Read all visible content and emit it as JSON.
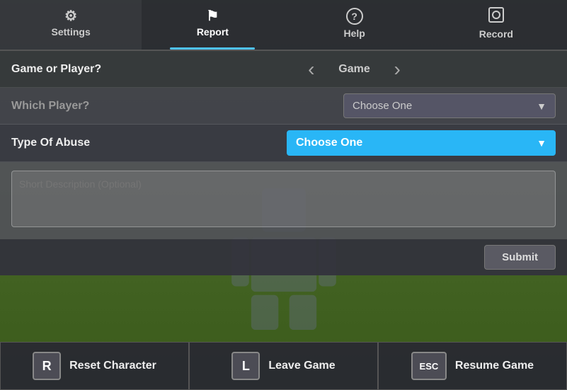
{
  "nav": {
    "items": [
      {
        "id": "settings",
        "label": "Settings",
        "icon": "⚙",
        "active": false
      },
      {
        "id": "report",
        "label": "Report",
        "icon": "⚑",
        "active": true
      },
      {
        "id": "help",
        "label": "Help",
        "icon": "?",
        "active": false
      },
      {
        "id": "record",
        "label": "Record",
        "icon": "◎",
        "active": false
      }
    ]
  },
  "report": {
    "game_player_label": "Game or Player?",
    "current_selection": "Game",
    "which_player_label": "Which Player?",
    "which_player_placeholder": "Choose One",
    "type_abuse_label": "Type Of Abuse",
    "type_abuse_placeholder": "Choose One",
    "description_placeholder": "Short Description (Optional)",
    "submit_label": "Submit"
  },
  "bottom_bar": {
    "reset": {
      "key": "R",
      "label": "Reset Character"
    },
    "leave": {
      "key": "L",
      "label": "Leave Game"
    },
    "resume": {
      "key": "ESC",
      "label": "Resume Game"
    }
  }
}
